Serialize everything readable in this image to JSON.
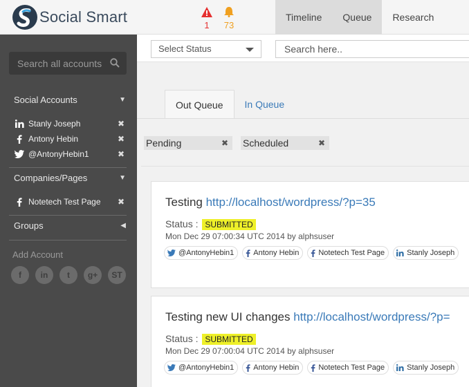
{
  "brand": {
    "name_part1": "Social",
    "name_part2": " Smart"
  },
  "notifications": {
    "alerts_count": "1",
    "bell_count": "73"
  },
  "nav": {
    "items": [
      "Timeline",
      "Queue",
      "Research"
    ]
  },
  "sidebar": {
    "search_placeholder": "Search all accounts",
    "social_accounts_label": "Social Accounts",
    "accounts": [
      {
        "network": "linkedin",
        "name": "Stanly Joseph"
      },
      {
        "network": "facebook",
        "name": "Antony Hebin"
      },
      {
        "network": "twitter",
        "name": "@AntonyHebin1"
      }
    ],
    "companies_label": "Companies/Pages",
    "companies": [
      {
        "network": "facebook",
        "name": "Notetech Test Page"
      }
    ],
    "groups_label": "Groups",
    "add_account_label": "Add Account",
    "add_buttons": [
      "f",
      "in",
      "t",
      "g+",
      "ST"
    ]
  },
  "filters": {
    "status_select_value": "Select Status",
    "search_placeholder": "Search here.."
  },
  "tabs": [
    "Out Queue",
    "In Queue"
  ],
  "chips": [
    "Pending",
    "Scheduled"
  ],
  "posts": [
    {
      "title_text": "Testing ",
      "title_link": "http://localhost/wordpress/?p=35",
      "status_label": "Status :",
      "status_value": "SUBMITTED",
      "meta": "Mon Dec 29 07:00:34 UTC 2014 by alphsuser",
      "tags": [
        {
          "network": "twitter",
          "name": "@AntonyHebin1"
        },
        {
          "network": "facebook",
          "name": "Antony Hebin"
        },
        {
          "network": "facebook",
          "name": "Notetech Test Page"
        },
        {
          "network": "linkedin",
          "name": "Stanly Joseph"
        }
      ]
    },
    {
      "title_text": "Testing new UI changes ",
      "title_link": "http://localhost/wordpress/?p=",
      "status_label": "Status :",
      "status_value": "SUBMITTED",
      "meta": "Mon Dec 29 07:00:04 UTC 2014 by alphsuser",
      "tags": [
        {
          "network": "twitter",
          "name": "@AntonyHebin1"
        },
        {
          "network": "facebook",
          "name": "Antony Hebin"
        },
        {
          "network": "facebook",
          "name": "Notetech Test Page"
        },
        {
          "network": "linkedin",
          "name": "Stanly Joseph"
        }
      ]
    }
  ],
  "colors": {
    "link": "#3a7ab8",
    "badge": "#eef029",
    "sidebar": "#4a4a4a",
    "alert": "#e53030",
    "bell": "#f0a020"
  }
}
